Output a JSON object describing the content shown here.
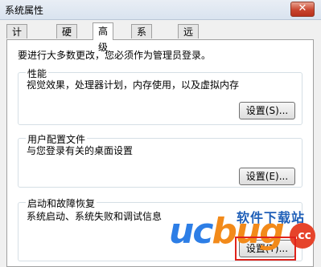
{
  "window": {
    "title": "系统属性",
    "close_label": "✕"
  },
  "tabs": [
    {
      "label": "计算机名",
      "active": false
    },
    {
      "label": "硬件",
      "active": false
    },
    {
      "label": "高级",
      "active": true
    },
    {
      "label": "系统保护",
      "active": false
    },
    {
      "label": "远程",
      "active": false
    }
  ],
  "intro_text": "要进行大多数更改，您必须作为管理员登录。",
  "sections": [
    {
      "title": "性能",
      "description": "视觉效果，处理器计划，内存使用，以及虚拟内存",
      "button_label": "设置(S)..."
    },
    {
      "title": "用户配置文件",
      "description": "与您登录有关的桌面设置",
      "button_label": "设置(E)..."
    },
    {
      "title": "启动和故障恢复",
      "description": "系统启动、系统失败和调试信息",
      "button_label": "设置(T)..."
    }
  ],
  "watermark": {
    "brand_left": "uc",
    "brand_right": "bug",
    "site_text": "软件下载站",
    "suffix": ".cc"
  },
  "colors": {
    "highlight": "#e0231c",
    "brand_blue": "#2d7ee6",
    "brand_orange": "#f28a1a"
  }
}
